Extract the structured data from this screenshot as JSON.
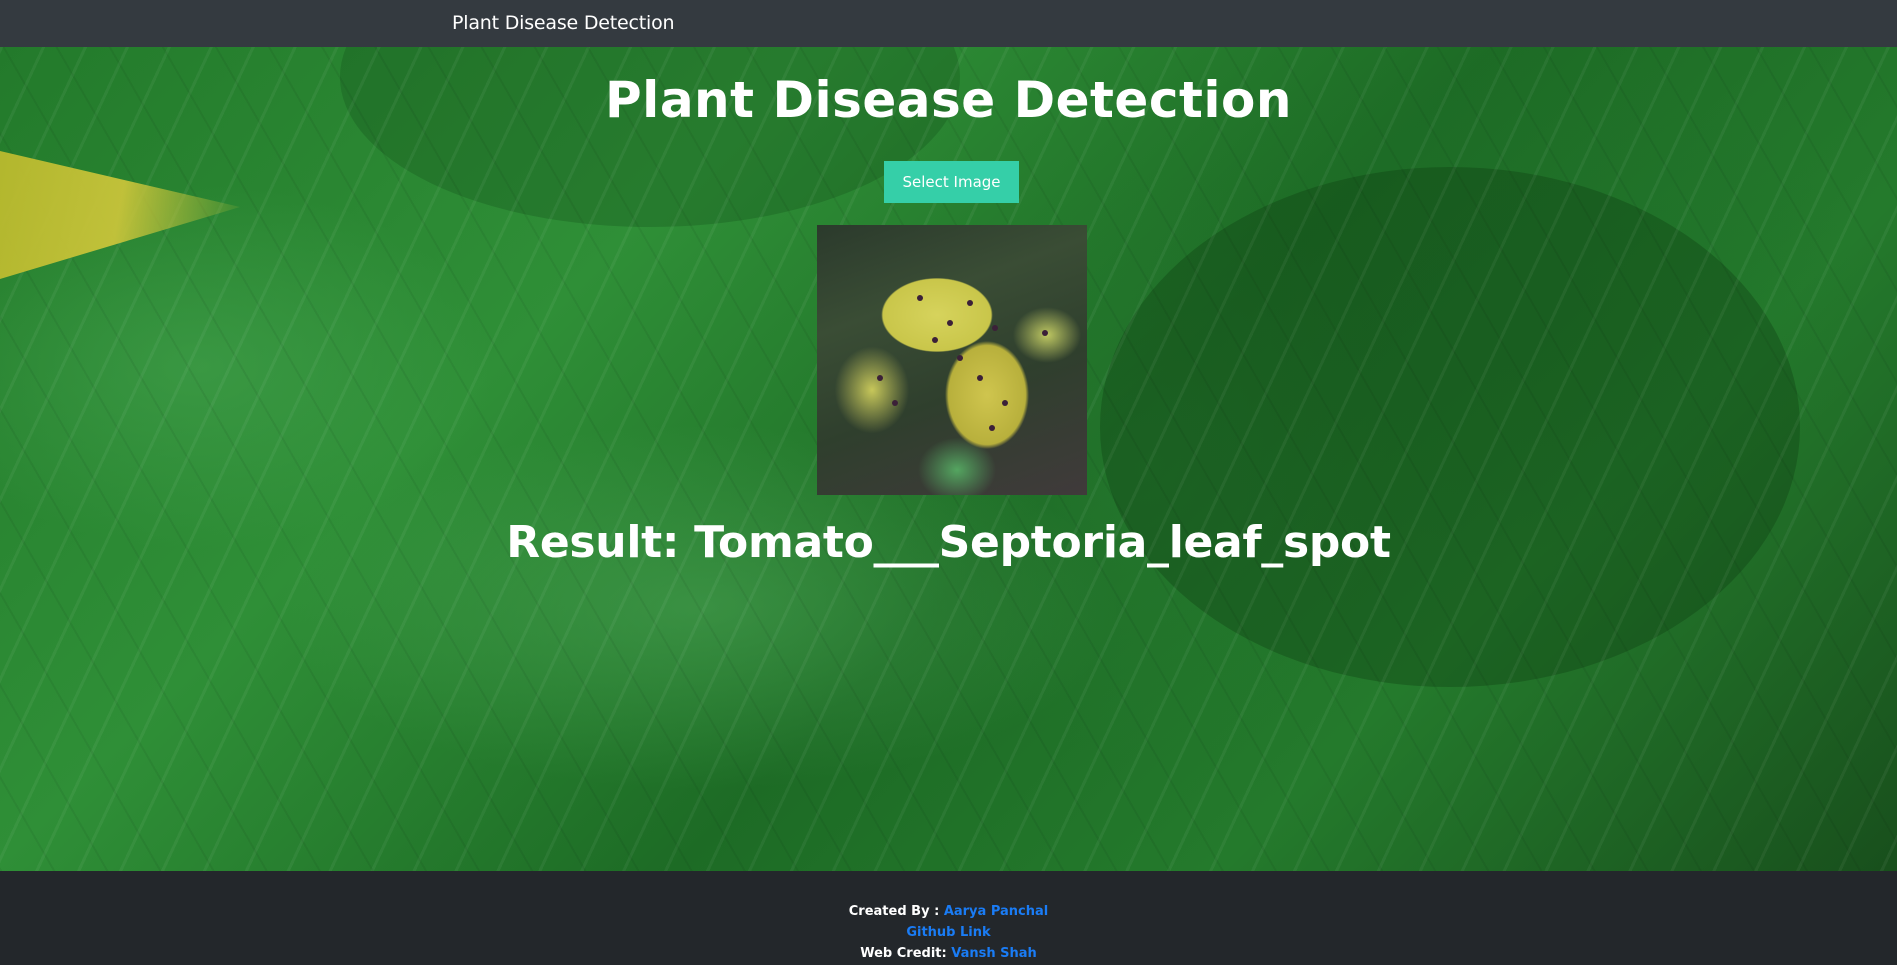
{
  "navbar": {
    "brand": "Plant Disease Detection"
  },
  "main": {
    "title": "Plant Disease Detection",
    "select_button_label": "Select Image",
    "result_text": "Result: Tomato___Septoria_leaf_spot"
  },
  "footer": {
    "created_by_label": "Created By :",
    "created_by_name": "Aarya Panchal",
    "github_link_label": "Github Link",
    "web_credit_label": "Web Credit:",
    "web_credit_name": "Vansh Shah"
  },
  "colors": {
    "navbar_bg": "#343a40",
    "button_bg": "#35cfa8",
    "footer_bg": "#23272b",
    "link": "#1a7cf5"
  }
}
